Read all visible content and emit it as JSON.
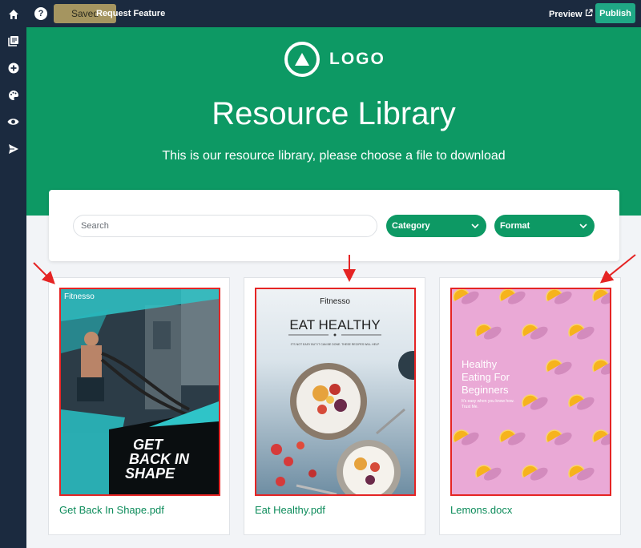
{
  "topbar": {
    "help_icon": "?",
    "saved_label": "Saved",
    "request_feature_label": "Request Feature",
    "preview_label": "Preview",
    "publish_label": "Publish"
  },
  "rail": {
    "icons": [
      "home-icon",
      "pages-icon",
      "add-icon",
      "palette-icon",
      "eye-icon",
      "send-icon"
    ]
  },
  "hero": {
    "logo_text": "LOGO",
    "title": "Resource Library",
    "subtitle": "This is our resource library, please choose a file to download"
  },
  "filters": {
    "search_placeholder": "Search",
    "category_label": "Category",
    "format_label": "Format"
  },
  "files": [
    {
      "name": "Get Back In Shape.pdf",
      "cover": {
        "brand": "Fitnesso",
        "headline": [
          "GET",
          "BACK IN",
          "SHAPE"
        ]
      }
    },
    {
      "name": "Eat Healthy.pdf",
      "cover": {
        "brand": "Fitnesso",
        "headline": "EAT HEALTHY",
        "tagline": "IT'S NOT EASY BUT IT CAN BE DONE. THESE RECIPES WILL HELP"
      }
    },
    {
      "name": "Lemons.docx",
      "cover": {
        "headline": [
          "Healthy",
          "Eating For",
          "Beginners"
        ],
        "tagline": [
          "It's easy when you know how.",
          "Trust Me."
        ]
      }
    }
  ],
  "colors": {
    "brand_green": "#0d9964",
    "nav_dark": "#1b2a3f",
    "publish": "#1fa885",
    "saved": "#a59560",
    "annotation_red": "#e52424"
  }
}
